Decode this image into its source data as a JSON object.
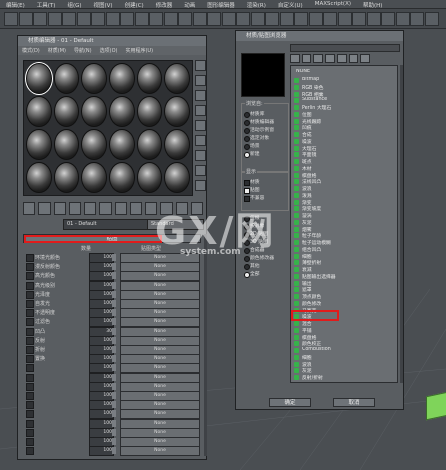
{
  "menubar": [
    "编辑(E)",
    "工具(T)",
    "组(G)",
    "视图(V)",
    "创建(C)",
    "修改器",
    "动画",
    "图形编辑器",
    "渲染(R)",
    "自定义(U)",
    "MAXScript(X)",
    "帮助(H)"
  ],
  "material_editor": {
    "title": "材质编辑器 - 01 - Default",
    "menu": [
      "模式(D)",
      "材质(M)",
      "导航(N)",
      "选项(O)",
      "实用程序(U)"
    ],
    "slot_count": 24,
    "material_name": "01 - Default",
    "material_type": "Standard",
    "rollout_title": "贴图",
    "header_amount": "数量",
    "header_map_type": "贴图类型",
    "maps": [
      {
        "label": "环境光颜色",
        "amount": "100",
        "map": "None"
      },
      {
        "label": "漫反射颜色",
        "amount": "100",
        "map": "None"
      },
      {
        "label": "高光颜色",
        "amount": "100",
        "map": "None"
      },
      {
        "label": "高光级别",
        "amount": "100",
        "map": "None"
      },
      {
        "label": "光泽度",
        "amount": "100",
        "map": "None"
      },
      {
        "label": "自发光",
        "amount": "100",
        "map": "None"
      },
      {
        "label": "不透明度",
        "amount": "100",
        "map": "None"
      },
      {
        "label": "过滤色",
        "amount": "100",
        "map": "None"
      },
      {
        "label": "凹凸",
        "amount": "30",
        "map": "None"
      },
      {
        "label": "反射",
        "amount": "100",
        "map": "None"
      },
      {
        "label": "折射",
        "amount": "100",
        "map": "None"
      },
      {
        "label": "置换",
        "amount": "100",
        "map": "None"
      },
      {
        "label": "",
        "amount": "100",
        "map": "None"
      },
      {
        "label": "",
        "amount": "100",
        "map": "None"
      },
      {
        "label": "",
        "amount": "100",
        "map": "None"
      },
      {
        "label": "",
        "amount": "100",
        "map": "None"
      },
      {
        "label": "",
        "amount": "100",
        "map": "None"
      },
      {
        "label": "",
        "amount": "100",
        "map": "None"
      },
      {
        "label": "",
        "amount": "100",
        "map": "None"
      },
      {
        "label": "",
        "amount": "100",
        "map": "None"
      },
      {
        "label": "",
        "amount": "100",
        "map": "None"
      },
      {
        "label": "",
        "amount": "100",
        "map": "None"
      }
    ]
  },
  "browser": {
    "title": "材质/贴图浏览器",
    "browse_from_label": "浏览自:",
    "browse_from": [
      "材质库",
      "材质编辑器",
      "活动示例窗",
      "选定对象",
      "场景",
      "新建"
    ],
    "show_label": "显示",
    "show_options": [
      "材质",
      "贴图",
      "不兼容"
    ],
    "extra_options": [
      "仅根",
      "按对象",
      "2D 贴图",
      "3D 贴图",
      "合成器",
      "颜色修改器",
      "其他",
      "全部"
    ],
    "list_header": "NONE",
    "items": [
      "Bitmap",
      "RGB 染色",
      "RGB 相乘",
      "Substance",
      "Perlin 大理石",
      "位图",
      "光线跟踪",
      "凹痕",
      "合成",
      "噪波",
      "大理石",
      "平面镜",
      "斑点",
      "木材",
      "棋盘格",
      "法线凹凸",
      "波浪",
      "泼溅",
      "渐变",
      "渐变坡度",
      "漩涡",
      "灰泥",
      "烟雾",
      "粒子年龄",
      "粒子运动模糊",
      "组合凹凸",
      "细胞",
      "薄壁折射",
      "衰减",
      "贴图输出选择器",
      "输出",
      "遮罩",
      "顶点颜色",
      "颜色修改",
      "马赛克",
      "噪波",
      "混合",
      "平铺",
      "棋盘格",
      "颜色校正",
      "Combustion",
      "细胞",
      "波浪",
      "灰泥",
      "反射/折射"
    ],
    "ok": "确定",
    "cancel": "取消"
  },
  "watermark": {
    "big": "GX/网",
    "small": "system.com"
  }
}
